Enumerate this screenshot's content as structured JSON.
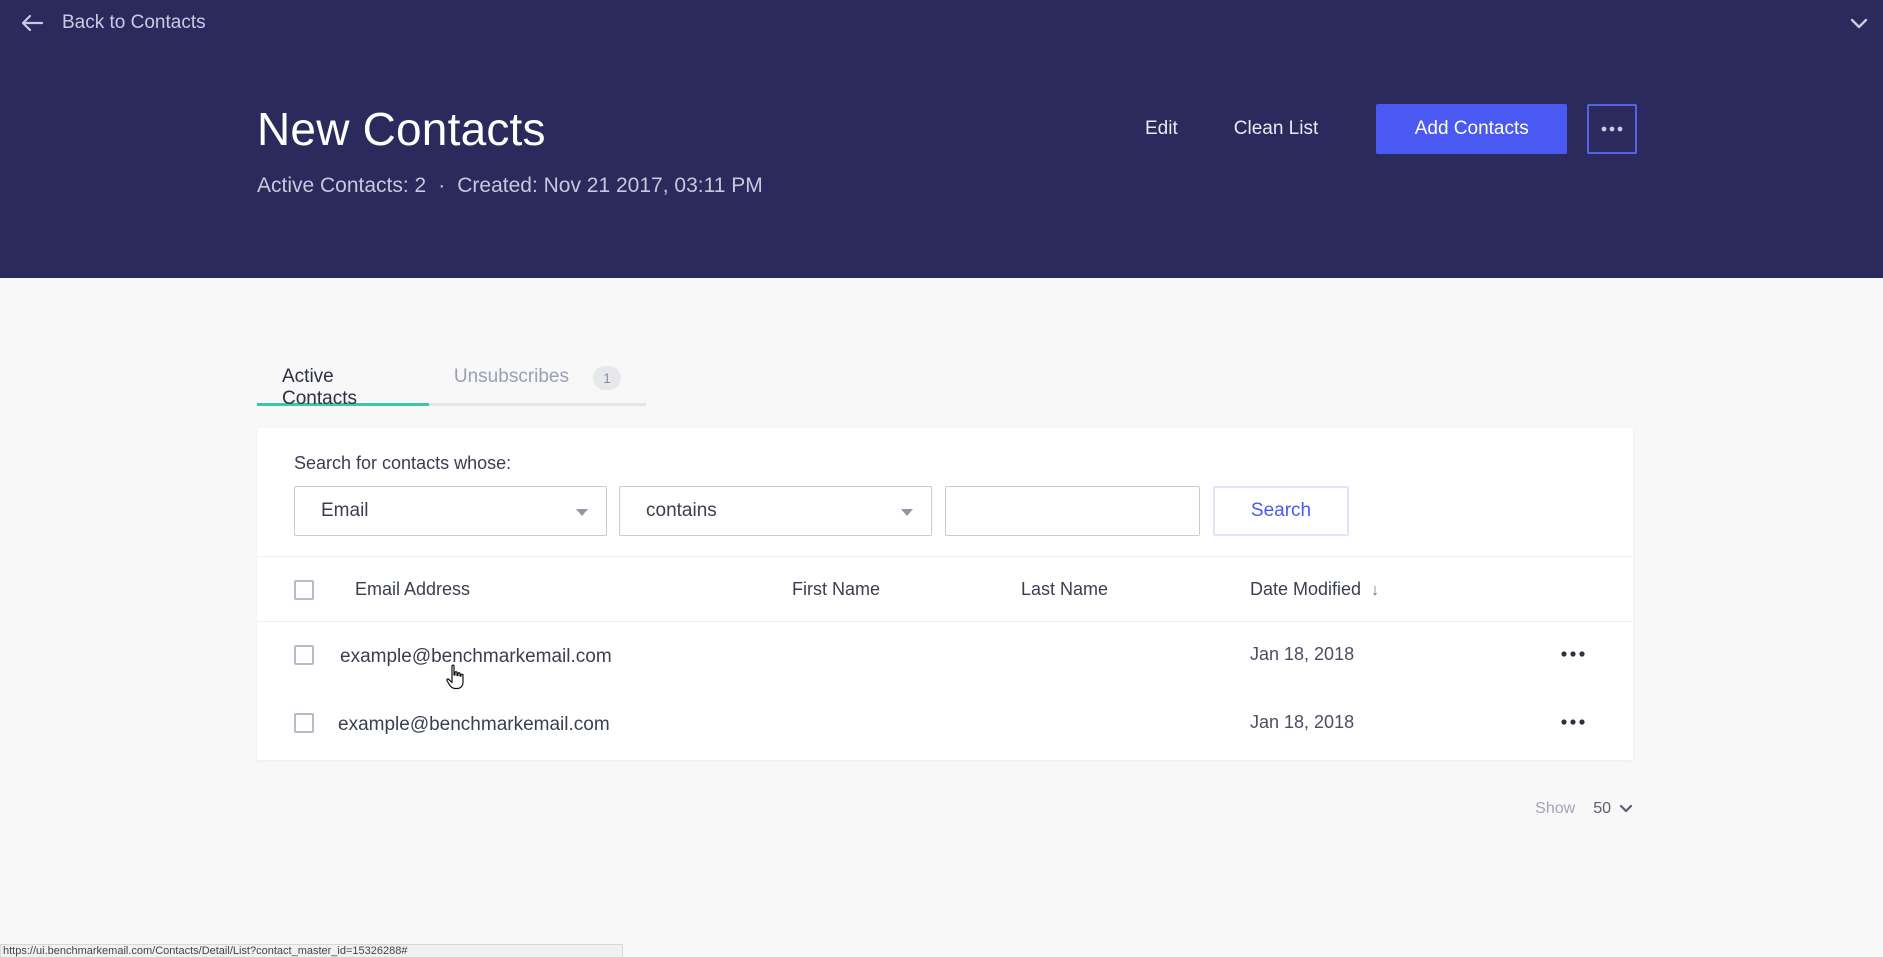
{
  "nav": {
    "back_label": "Back to Contacts"
  },
  "header": {
    "title": "New Contacts",
    "active_contacts": "Active Contacts: 2",
    "separator": "·",
    "created": "Created: Nov 21 2017, 03:11 PM",
    "edit_label": "Edit",
    "clean_label": "Clean List",
    "add_label": "Add Contacts"
  },
  "tabs": [
    {
      "label": "Active Contacts",
      "active": true
    },
    {
      "label": "Unsubscribes",
      "badge": "1",
      "active": false
    }
  ],
  "search": {
    "label": "Search for contacts whose:",
    "field_value": "Email",
    "operator_value": "contains",
    "query_value": "",
    "button_label": "Search"
  },
  "table": {
    "columns": [
      "Email Address",
      "First Name",
      "Last Name",
      "Date Modified"
    ],
    "sort_indicator": "↓",
    "rows": [
      {
        "email": "example@benchmarkemail.com",
        "first_name": "",
        "last_name": "",
        "date_modified": "Jan 18, 2018"
      },
      {
        "email": "example@benchmarkemail.com",
        "first_name": "",
        "last_name": "",
        "date_modified": "Jan 18, 2018"
      }
    ]
  },
  "pager": {
    "show_label": "Show",
    "page_size": "50"
  },
  "status_bar": {
    "url": "https://ui.benchmarkemail.com/Contacts/Detail/List?contact_master_id=15326288#"
  },
  "colors": {
    "header_bg": "#2a2a5c",
    "primary": "#4a59f2",
    "tab_active": "#3cc7a6"
  }
}
